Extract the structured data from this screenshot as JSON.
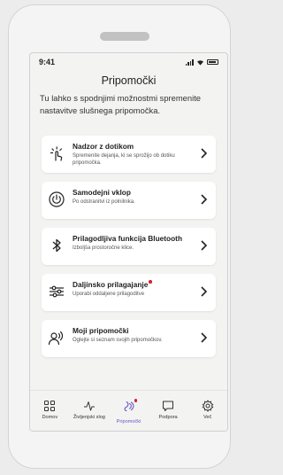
{
  "status": {
    "time": "9:41"
  },
  "header": {
    "title": "Pripomočki"
  },
  "intro": "Tu lahko s spodnjimi možnostmi spremenite nastavitve slušnega pripomočka.",
  "items": [
    {
      "title": "Nadzor z dotikom",
      "subtitle": "Spremenite dejanja, ki se sprožijo ob dotiku pripomočka.",
      "icon": "touch-control-icon",
      "notification": false
    },
    {
      "title": "Samodejni vklop",
      "subtitle": "Po odstranitvi iz polnilnika.",
      "icon": "power-icon",
      "notification": false
    },
    {
      "title": "Prilagodljiva funkcija Bluetooth",
      "subtitle": "Izboljša prostoročne klice.",
      "icon": "bluetooth-icon",
      "notification": false
    },
    {
      "title": "Daljinsko prilagajanje",
      "subtitle": "Uporabi oddaljene prilagoditve",
      "icon": "sliders-icon",
      "notification": true
    },
    {
      "title": "Moji pripomočki",
      "subtitle": "Oglejte si seznam svojih pripomočkov.",
      "icon": "hearing-aid-user-icon",
      "notification": false
    }
  ],
  "tabs": [
    {
      "label": "Domov",
      "icon": "home-grid-icon",
      "active": false
    },
    {
      "label": "Življenjski slog",
      "icon": "activity-icon",
      "active": false
    },
    {
      "label": "Pripomočki",
      "icon": "hearing-aid-icon",
      "active": true
    },
    {
      "label": "Podpora",
      "icon": "chat-icon",
      "active": false
    },
    {
      "label": "Več",
      "icon": "gear-icon",
      "active": false
    }
  ],
  "colors": {
    "accent": "#6a58c7",
    "notification": "#d0232e",
    "card": "#ffffff",
    "background": "#f3f3f2"
  }
}
